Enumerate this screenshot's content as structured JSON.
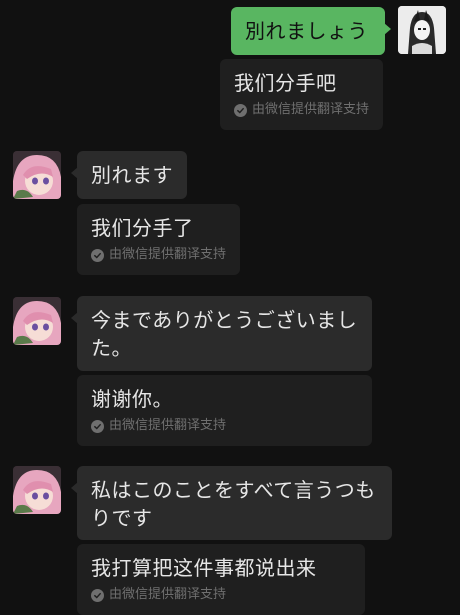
{
  "messages": [
    {
      "sender": "self",
      "text": "別れましょう",
      "translation": "我们分手吧",
      "translation_credit": "由微信提供翻译支持"
    },
    {
      "sender": "other",
      "text": "別れます",
      "translation": "我们分手了",
      "translation_credit": "由微信提供翻译支持"
    },
    {
      "sender": "other",
      "text": "今までありがとうございました。",
      "translation": "谢谢你。",
      "translation_credit": "由微信提供翻译支持"
    },
    {
      "sender": "other",
      "text": "私はこのことをすべて言うつもりです",
      "translation": "我打算把这件事都说出来",
      "translation_credit": "由微信提供翻译支持"
    }
  ],
  "colors": {
    "background": "#111111",
    "outgoing_bubble": "#59b661",
    "incoming_bubble": "#2b2b2b",
    "translation_bubble": "#1f1f1f",
    "credit_text": "#6f6f6f"
  },
  "icons": {
    "self_avatar": "avatar-self",
    "other_avatar": "avatar-pink-hair",
    "credit_icon": "check-circle-icon"
  }
}
